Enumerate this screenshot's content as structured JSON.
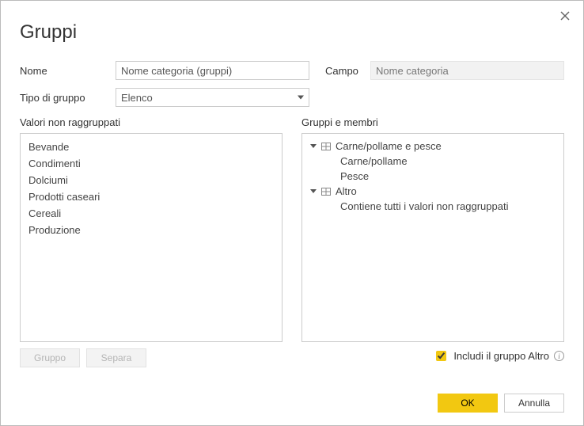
{
  "dialog": {
    "title": "Gruppi",
    "labels": {
      "name": "Nome",
      "field": "Campo",
      "group_type": "Tipo di gruppo"
    },
    "values": {
      "name": "Nome categoria (gruppi)",
      "field": "Nome categoria",
      "group_type": "Elenco"
    }
  },
  "left": {
    "header": "Valori non raggruppati",
    "items": [
      "Bevande",
      "Condimenti",
      "Dolciumi",
      "Prodotti caseari",
      "Cereali",
      "Produzione"
    ],
    "buttons": {
      "group": "Gruppo",
      "ungroup": "Separa"
    }
  },
  "right": {
    "header": "Gruppi e membri",
    "groups": [
      {
        "name": "Carne/pollame e pesce",
        "children": [
          "Carne/pollame",
          "Pesce"
        ]
      },
      {
        "name": "Altro",
        "children": [
          "Contiene tutti i valori non raggruppati"
        ]
      }
    ],
    "include_other_label": "Includi il gruppo Altro",
    "include_other_checked": true
  },
  "footer": {
    "ok": "OK",
    "cancel": "Annulla"
  }
}
